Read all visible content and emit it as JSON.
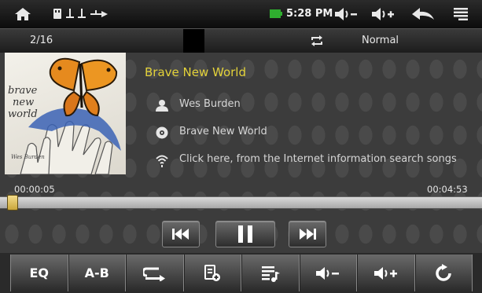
{
  "status": {
    "time": "5:28 PM",
    "icons": [
      "home-icon",
      "sd-card-icon",
      "usb-icon",
      "usb-icon",
      "usb-debug-icon",
      "battery-icon",
      "volume-down-icon",
      "volume-up-icon",
      "back-icon",
      "menu-icon"
    ],
    "volume_down_label": "◄)−",
    "volume_up_label": "◄)+"
  },
  "player": {
    "track_position": "2/16",
    "play_mode": "Normal",
    "song_title": "Brave New World",
    "artist": "Wes Burden",
    "album": "Brave New World",
    "lyrics_hint": "Click here, from the Internet information search songs",
    "elapsed": "00:00:05",
    "duration": "00:04:53",
    "progress_fraction": 0.017
  },
  "cover": {
    "text_line1": "brave",
    "text_line2": "new",
    "text_line3": "world",
    "artist_sig": "Wes Burden"
  },
  "toolbar": {
    "eq_label": "EQ",
    "ab_label": "A-B",
    "icons": [
      "repeat-icon",
      "add-to-playlist-icon",
      "playlist-icon",
      "volume-down-icon",
      "volume-up-icon",
      "refresh-icon"
    ]
  },
  "colors": {
    "title_accent": "#e3d23a",
    "progress_knob": "#d8b651"
  }
}
